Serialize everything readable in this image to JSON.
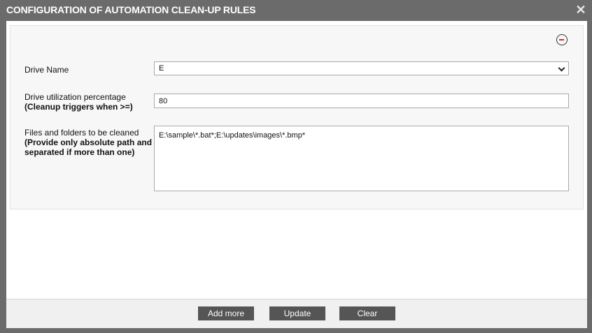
{
  "dialog": {
    "title": "CONFIGURATION OF AUTOMATION CLEAN-UP RULES",
    "close_glyph": "✕"
  },
  "form": {
    "drive_name": {
      "label": "Drive Name",
      "value": "E"
    },
    "utilization": {
      "label": "Drive utilization percentage",
      "sublabel": "(Cleanup triggers when >=)",
      "value": "80"
    },
    "files": {
      "label": "Files and folders to be cleaned",
      "sublabel_line1": "(Provide only absolute path and ;",
      "sublabel_line2": "separated if more than one)",
      "value": "E:\\sample\\*.bat*;E:\\updates\\images\\*.bmp*"
    }
  },
  "footer": {
    "add_more": "Add more",
    "update": "Update",
    "clear": "Clear"
  },
  "icons": {
    "remove": "minus-circle-icon",
    "close": "close-icon",
    "dropdown": "chevron-down-icon"
  }
}
